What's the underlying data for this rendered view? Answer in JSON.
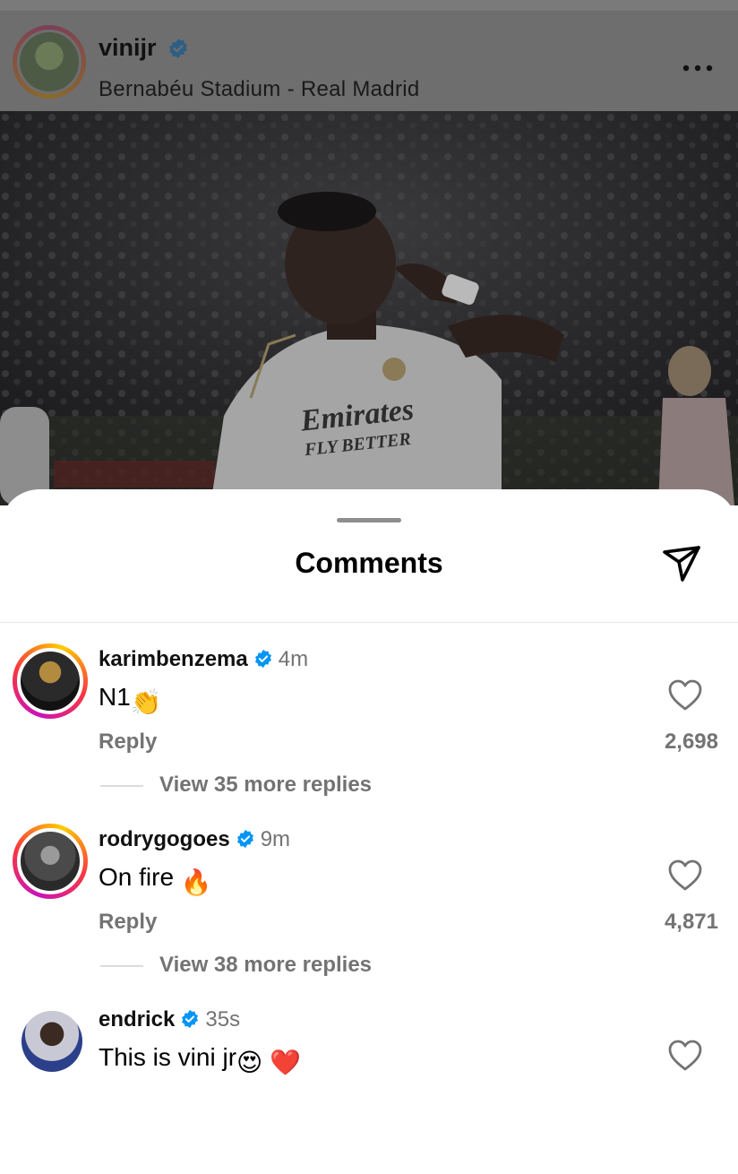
{
  "post": {
    "username": "vinijr",
    "location": "Bernabéu Stadium - Real Madrid",
    "more_icon": "ellipsis-icon",
    "verified_icon": "verified-badge-icon",
    "photo_jersey_line1": "Emirates",
    "photo_jersey_line2": "FLY BETTER"
  },
  "sheet": {
    "title": "Comments",
    "share_icon": "paper-plane-icon"
  },
  "comments": [
    {
      "username": "karimbenzema",
      "time": "4m",
      "text": "N1",
      "emoji": "👏",
      "reply_label": "Reply",
      "likes": "2,698",
      "view_replies": "View 35 more replies"
    },
    {
      "username": "rodrygogoes",
      "time": "9m",
      "text": "On fire ",
      "emoji": "🔥",
      "reply_label": "Reply",
      "likes": "4,871",
      "view_replies": "View 38 more replies"
    },
    {
      "username": "endrick",
      "time": "35s",
      "text": "This is vini jr",
      "emoji": "😍 ❤️"
    }
  ],
  "colors": {
    "accent_verified": "#0095f6",
    "secondary_text": "#737373",
    "story_ring_start": "#c913b9",
    "story_ring_end": "#fecd00"
  }
}
